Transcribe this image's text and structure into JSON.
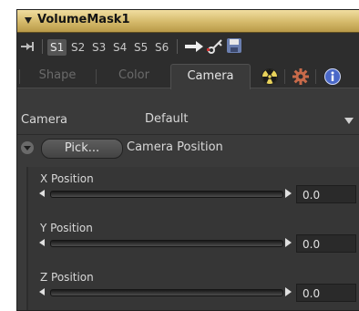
{
  "panel": {
    "title": "VolumeMask1"
  },
  "toolbar": {
    "slots": [
      "S1",
      "S2",
      "S3",
      "S4",
      "S5",
      "S6"
    ],
    "active_slot": "S1"
  },
  "tabs": [
    {
      "label": "Shape"
    },
    {
      "label": "Color"
    },
    {
      "label": "Camera"
    }
  ],
  "active_tab": "Camera",
  "camera": {
    "label": "Camera",
    "value": "Default"
  },
  "pick": {
    "button_label": "Pick...",
    "section_label": "Camera Position"
  },
  "sliders": [
    {
      "label": "X Position",
      "value": "0.0"
    },
    {
      "label": "Y Position",
      "value": "0.0"
    },
    {
      "label": "Z Position",
      "value": "0.0"
    }
  ],
  "colors": {
    "title_bar": "#d4b96a",
    "panel_bg": "#3a3a3a",
    "toolbar_bg": "#2d2d2d",
    "text": "#d8d8d8"
  },
  "icons": [
    "collapse-arrow-icon",
    "pin-icon",
    "insert-arrow-icon",
    "key-icon",
    "save-icon",
    "radioactive-icon",
    "gear-icon",
    "info-icon",
    "dropdown-arrow-icon"
  ]
}
